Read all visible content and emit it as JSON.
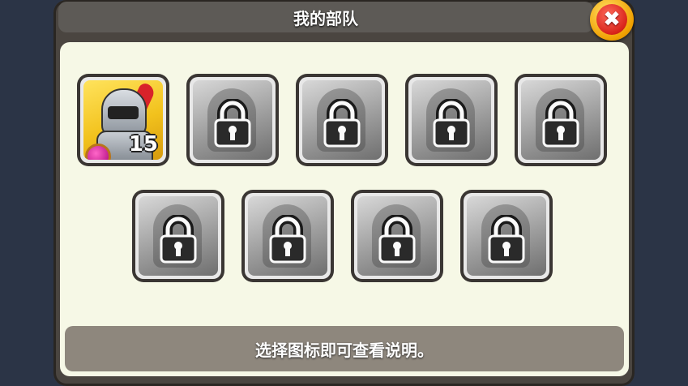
{
  "header": {
    "title": "我的部队"
  },
  "close_button": {
    "icon": "close-icon",
    "glyph": "✖"
  },
  "units": [
    {
      "id": "knight",
      "locked": false,
      "level": "15",
      "icon": "knight-icon"
    },
    {
      "id": "unit-2",
      "locked": true,
      "icon": "lock-icon"
    },
    {
      "id": "unit-3",
      "locked": true,
      "icon": "lock-icon"
    },
    {
      "id": "unit-4",
      "locked": true,
      "icon": "lock-icon"
    },
    {
      "id": "unit-5",
      "locked": true,
      "icon": "lock-icon"
    },
    {
      "id": "unit-6",
      "locked": true,
      "icon": "lock-icon"
    },
    {
      "id": "unit-7",
      "locked": true,
      "icon": "lock-icon"
    },
    {
      "id": "unit-8",
      "locked": true,
      "icon": "lock-icon"
    },
    {
      "id": "unit-9",
      "locked": true,
      "icon": "lock-icon"
    }
  ],
  "footer": {
    "hint": "选择图标即可查看说明。"
  },
  "colors": {
    "panel": "#4a4540",
    "content": "#f6f8e6",
    "close_red": "#d8231a",
    "close_gold": "#f0a000",
    "hint_bar": "#8e877d"
  }
}
